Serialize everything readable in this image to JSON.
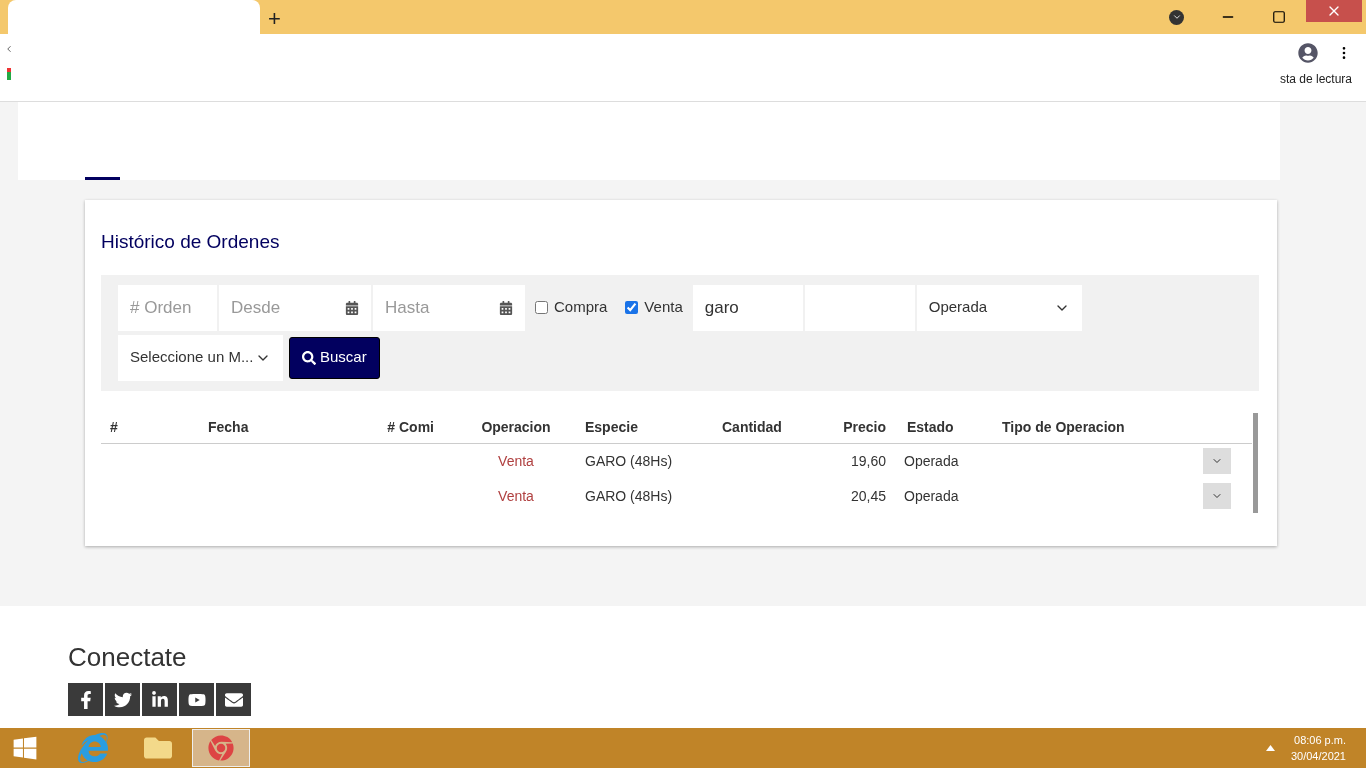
{
  "browser": {
    "new_tab": "+",
    "reading_list": "sta de lectura"
  },
  "page": {
    "title": "Histórico de Ordenes",
    "filters": [
      {
        "kind": "text",
        "placeholder": "# Orden"
      },
      {
        "kind": "date",
        "placeholder": "Desde"
      },
      {
        "kind": "date",
        "placeholder": "Hasta"
      },
      {
        "kind": "checkbox",
        "label": "Compra",
        "checked": false
      },
      {
        "kind": "checkbox",
        "label": "Venta",
        "checked": true
      },
      {
        "kind": "text",
        "value": "garo"
      },
      {
        "kind": "text"
      },
      {
        "kind": "select",
        "value": "Operada"
      },
      {
        "kind": "select",
        "value": "Seleccione un M..."
      },
      {
        "kind": "button",
        "label": "Buscar"
      }
    ],
    "table": {
      "columns": [
        "#",
        "Fecha",
        "# Comi",
        "Operacion",
        "Especie",
        "Cantidad",
        "Precio",
        "Estado",
        "Tipo de Operacion"
      ],
      "rows": [
        {
          "operacion": "Venta",
          "especie": "GARO (48Hs)",
          "precio": "19,60",
          "estado": "Operada"
        },
        {
          "operacion": "Venta",
          "especie": "GARO (48Hs)",
          "precio": "20,45",
          "estado": "Operada"
        }
      ]
    }
  },
  "footer": {
    "title": "Conectate",
    "social": [
      {
        "kind": "facebook"
      },
      {
        "kind": "twitter"
      },
      {
        "kind": "linkedin"
      },
      {
        "kind": "youtube"
      },
      {
        "kind": "email"
      }
    ]
  },
  "taskbar": {
    "time": "08:06 p.m.",
    "date": "30/04/2021"
  }
}
